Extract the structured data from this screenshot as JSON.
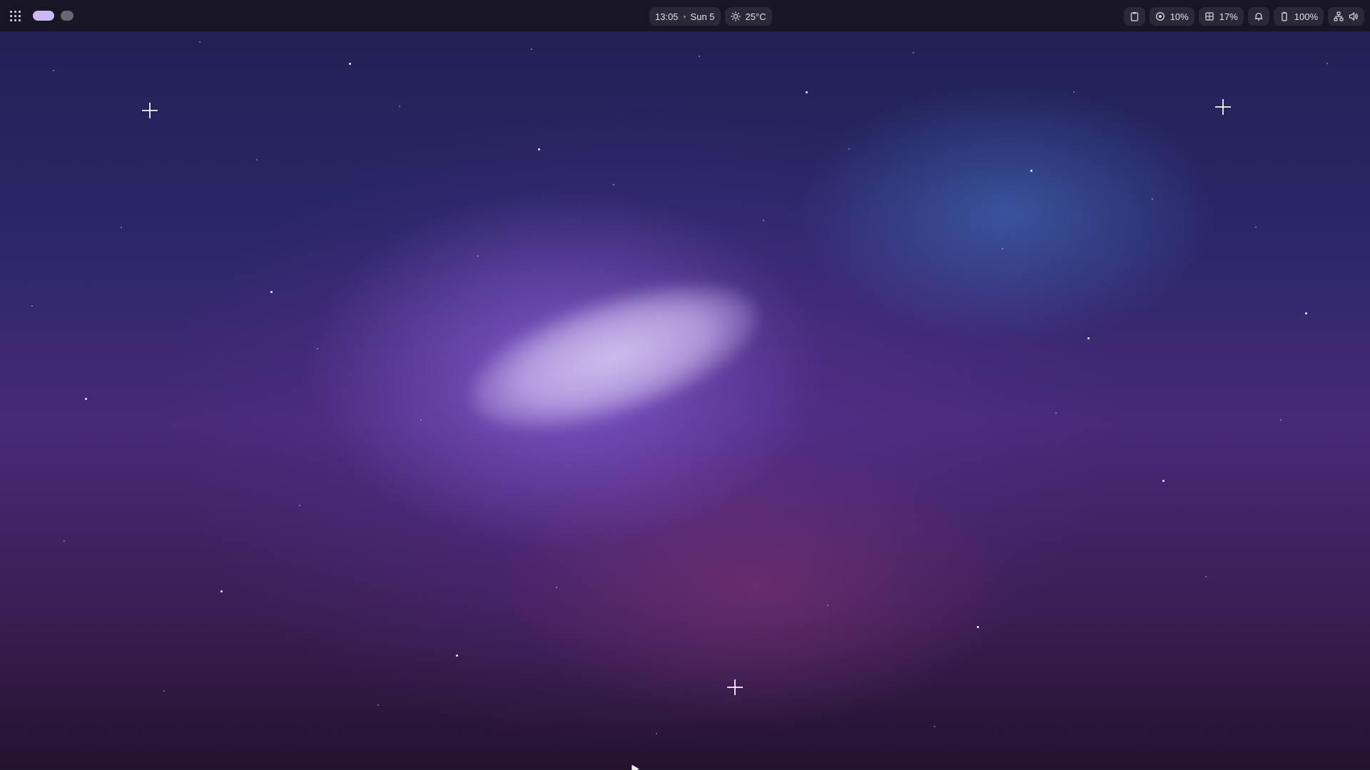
{
  "topbar": {
    "workspaces": {
      "active_color": "#c9b8f5",
      "inactive_color": "#6a6674"
    },
    "clock": {
      "time": "13:05",
      "date": "Sun 5"
    },
    "weather": {
      "icon": "sun-icon",
      "temperature": "25°C"
    },
    "tray": {
      "clipboard_icon": "clipboard-icon",
      "cpu": {
        "icon": "cpu-icon",
        "value": "10%"
      },
      "memory": {
        "icon": "memory-icon",
        "value": "17%"
      },
      "notifications_icon": "bell-icon",
      "battery": {
        "icon": "battery-icon",
        "value": "100%"
      },
      "network_icon": "network-icon",
      "volume_icon": "volume-icon"
    }
  },
  "wallpaper": {
    "colors": {
      "top": "#1e2152",
      "middle": "#472a78",
      "bottom": "#22132e",
      "glow": "#d6c8f0",
      "blue_haze": "#4678c8"
    }
  }
}
